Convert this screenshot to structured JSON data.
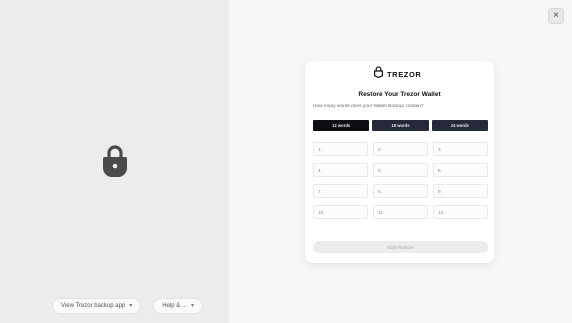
{
  "left_pane": {
    "icon": "lock-icon",
    "buttons": [
      {
        "label": "View Trezor backup app",
        "icon": "chevron-down-icon"
      },
      {
        "label": "Help & ...",
        "icon": "chevron-down-icon"
      }
    ]
  },
  "right_pane": {
    "close_label": "×",
    "card": {
      "logo_text": "TREZOR",
      "logo_icon": "trezor-logo-icon",
      "title": "Restore Your Trezor Wallet",
      "subtitle": "How many words does your Wallet Backup contain?",
      "word_count_options": [
        "12 words",
        "18 words",
        "24 words"
      ],
      "selected_option": "12 words",
      "word_fields": [
        {
          "number": "1."
        },
        {
          "number": "2."
        },
        {
          "number": "3."
        },
        {
          "number": "4."
        },
        {
          "number": "5."
        },
        {
          "number": "6."
        },
        {
          "number": "7."
        },
        {
          "number": "8."
        },
        {
          "number": "9."
        },
        {
          "number": "10."
        },
        {
          "number": "11."
        },
        {
          "number": "12."
        }
      ],
      "continue_label": "Start Restore"
    }
  },
  "colors": {
    "left_bg": "#ececec",
    "right_bg": "#f6f6f6",
    "option_bg": "#25293a",
    "option_selected_bg": "#0e0e12",
    "button_disabled_bg": "#ececec"
  }
}
